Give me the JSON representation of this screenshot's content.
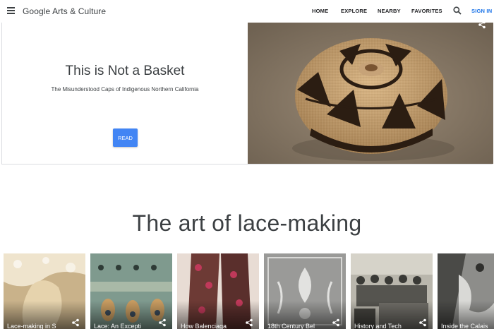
{
  "header": {
    "brand": "Google Arts & Culture",
    "nav": [
      "HOME",
      "EXPLORE",
      "NEARBY",
      "FAVORITES"
    ],
    "sign_in": "SIGN IN"
  },
  "feature": {
    "title": "This is Not a Basket",
    "subtitle": "The Misunderstood Caps of Indigenous Northern California",
    "button": "READ"
  },
  "section": {
    "title": "The art of lace-making"
  },
  "cards": [
    {
      "label": "Lace-making in S"
    },
    {
      "label": "Lace: An Excepti"
    },
    {
      "label": "How Balenciaga"
    },
    {
      "label": "18th Century Bel"
    },
    {
      "label": "History and Tech"
    },
    {
      "label": "Inside the Calais"
    }
  ],
  "colors": {
    "accent": "#1a73e8",
    "read_button": "#4285f4"
  }
}
